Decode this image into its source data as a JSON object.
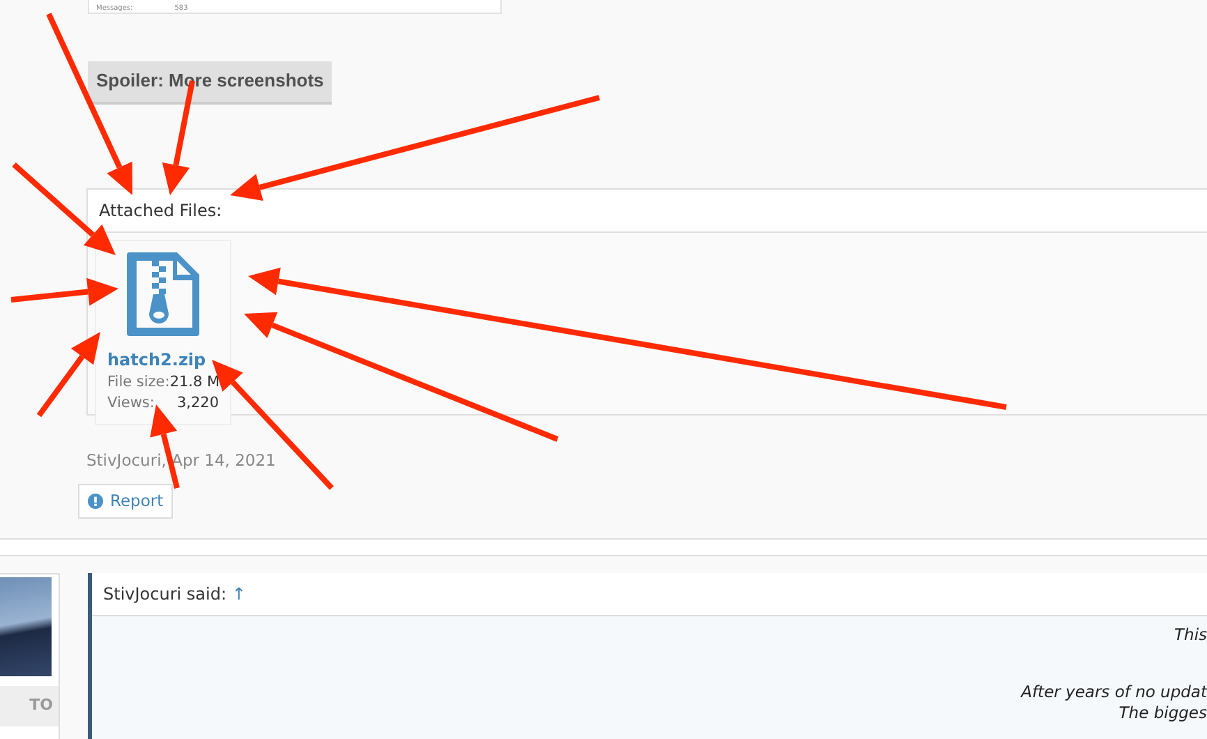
{
  "top_card": {
    "label": "Messages:",
    "value": "583"
  },
  "spoiler": {
    "label": "Spoiler: More screenshots"
  },
  "attachments": {
    "title": "Attached Files:",
    "files": [
      {
        "name": "hatch2.zip",
        "size_label": "File size:",
        "size": "21.8 M",
        "views_label": "Views:",
        "views": "3,220"
      }
    ]
  },
  "post_meta": {
    "author_date": "StivJocuri, Apr 14, 2021",
    "report": "Report"
  },
  "next_post": {
    "user_title": "TO",
    "quote": {
      "header": "StivJocuri said:",
      "jump": "↑",
      "lines": [
        "This",
        "After years of no updat",
        "The bigges"
      ]
    }
  }
}
